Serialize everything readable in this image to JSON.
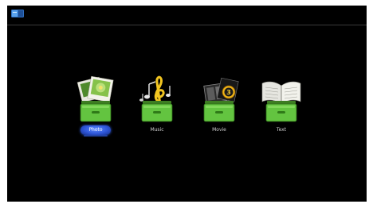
{
  "colors": {
    "screen_background": "#000000",
    "drawer_green": "#63c440",
    "selection_blue": "#2e56d8",
    "source_icon_blue": "#3f86d6"
  },
  "topbar": {
    "source_icon": "input-source-icon"
  },
  "menu": {
    "selected_index": 0,
    "items": [
      {
        "label": "Photo",
        "icon": "photo-icon"
      },
      {
        "label": "Music",
        "icon": "music-icon"
      },
      {
        "label": "Movie",
        "icon": "movie-icon"
      },
      {
        "label": "Text",
        "icon": "text-icon"
      }
    ]
  }
}
